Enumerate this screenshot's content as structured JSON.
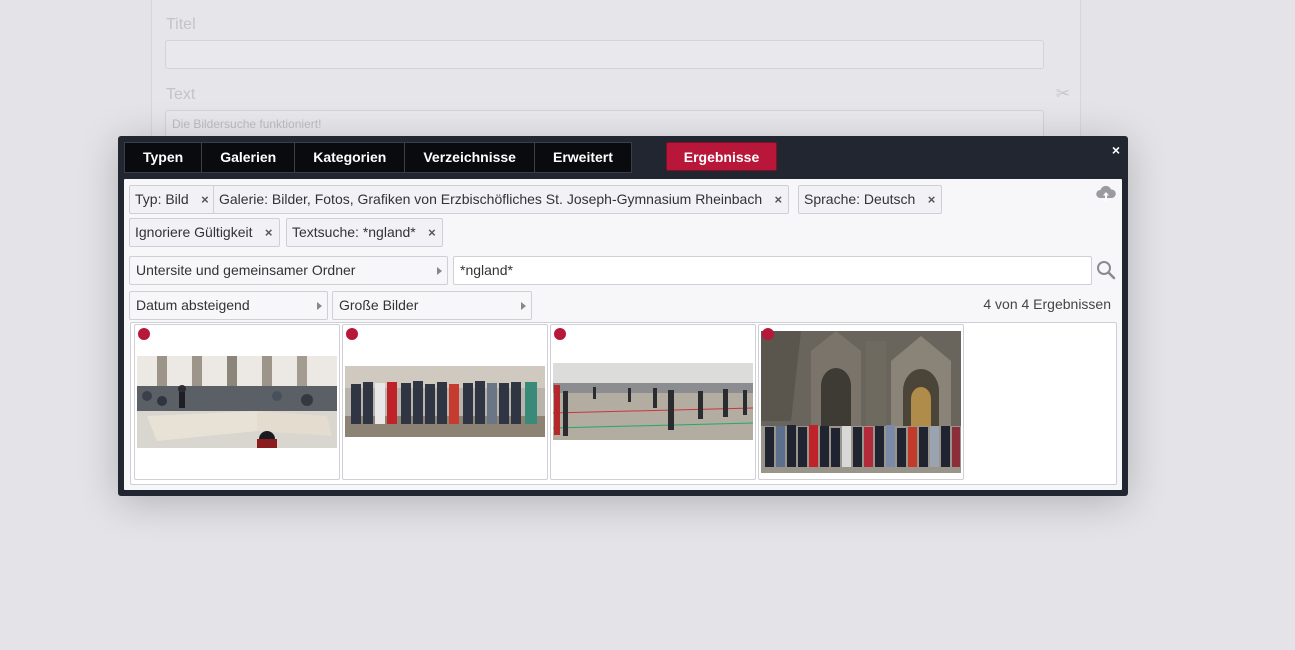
{
  "background_form": {
    "title_label": "Titel",
    "text_label": "Text",
    "text_value": "Die Bildersuche funktioniert!"
  },
  "tabs": [
    "Typen",
    "Galerien",
    "Kategorien",
    "Verzeichnisse",
    "Erweitert"
  ],
  "results_button": "Ergebnisse",
  "close_label": "×",
  "filters": [
    {
      "label": "Typ: Bild"
    },
    {
      "label": "Galerie: Bilder, Fotos, Grafiken von Erzbischöfliches St. Joseph-Gymnasium Rheinbach"
    },
    {
      "label": "Sprache: Deutsch"
    },
    {
      "label": "Ignoriere Gültigkeit"
    },
    {
      "label": "Textsuche: *ngland*"
    }
  ],
  "remove_label": "×",
  "scope_select": "Untersite und gemeinsamer Ordner",
  "search_value": "*ngland*",
  "sort_select": "Datum absteigend",
  "size_select": "Große Bilder",
  "result_count": "4 von 4 Ergebnissen",
  "colors": {
    "accent": "#b8173a",
    "dialog_bg": "#222630",
    "panel_bg": "#f7f7fa"
  },
  "icons": {
    "upload": "cloud-upload-icon",
    "search": "search-icon",
    "scissors": "scissors-icon",
    "close": "close-icon"
  }
}
